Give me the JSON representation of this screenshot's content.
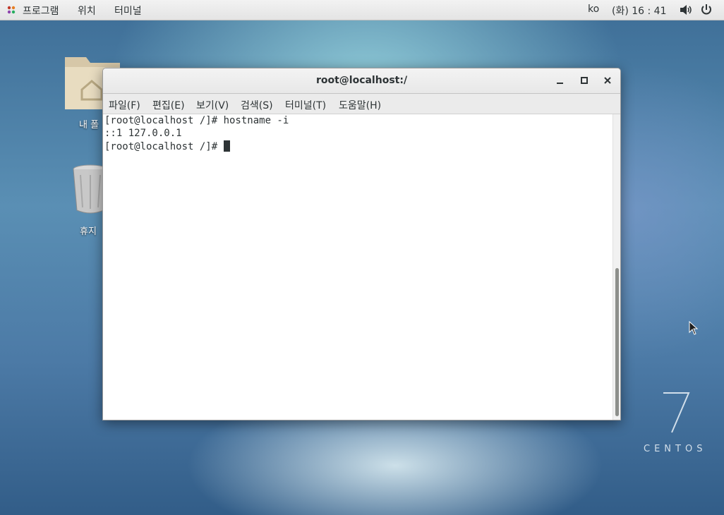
{
  "topbar": {
    "applications": "프로그램",
    "places": "위치",
    "terminal": "터미널",
    "language": "ko",
    "clock": "(화) 16 : 41",
    "icons": [
      "applications-icon",
      "volume-icon",
      "power-icon"
    ]
  },
  "desktop": {
    "home_label": "내 폴",
    "trash_label": "휴지",
    "branding_number": "7",
    "branding_text": "CENTOS"
  },
  "window": {
    "title": "root@localhost:/",
    "menu": [
      "파일(F)",
      "편집(E)",
      "보기(V)",
      "검색(S)",
      "터미널(T)",
      "도움말(H)"
    ],
    "lines": [
      "[root@localhost /]# hostname -i",
      "::1 127.0.0.1",
      "[root@localhost /]# "
    ]
  },
  "colors": {
    "text": "#2e3436",
    "panel": "#ebebeb",
    "desktop_blue": "#4c7aa6"
  }
}
